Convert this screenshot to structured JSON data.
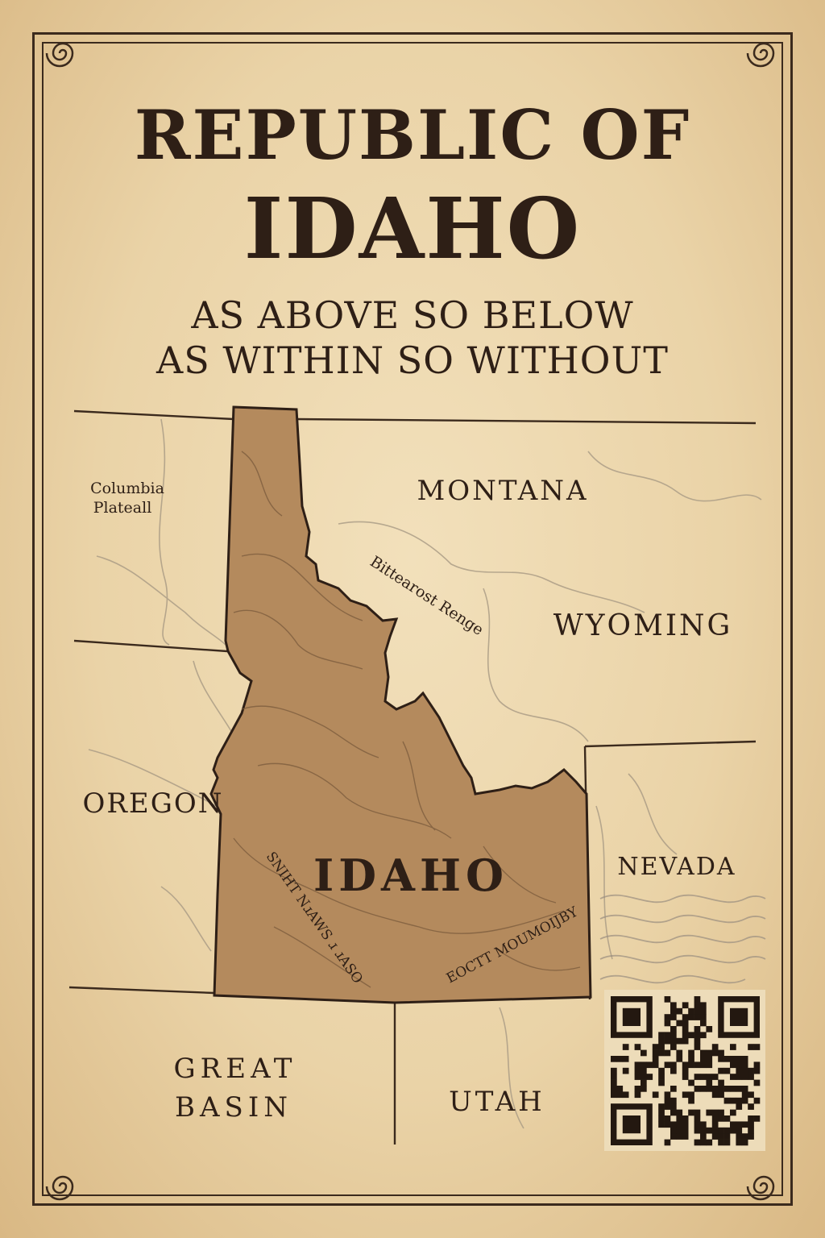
{
  "header": {
    "title_line1": "REPUBLIC OF",
    "title_line2": "IDAHO",
    "motto_line1": "AS ABOVE SO BELOW",
    "motto_line2": "AS WITHIN SO WITHOUT"
  },
  "map": {
    "regions": {
      "montana": "MONTANA",
      "wyoming": "WYOMING",
      "oregon": "OREGON",
      "nevada": "NEVADA",
      "great_basin_line1": "GREAT",
      "great_basin_line2": "BASIN",
      "utah": "UTAH",
      "idaho": "IDAHO"
    },
    "features": {
      "columbia_line1": "Columbia",
      "columbia_line2": "Plateall",
      "bitterroot": "Bittearost Renge",
      "left_mountains": "SNIHT NɹAWS ɹ ɹASO",
      "right_mountains": "EOCTT MOUMOIJBY"
    }
  },
  "colors": {
    "paper": "#ead3a7",
    "ink": "#2e1f16",
    "idaho_fill": "#b48a5d",
    "river": "#a89a84"
  },
  "qr_code": {
    "icon": "qr-code-icon"
  }
}
